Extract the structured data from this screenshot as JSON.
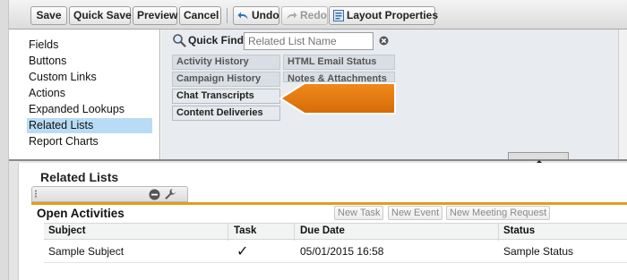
{
  "toolbar": {
    "save": "Save",
    "quick_save": "Quick Save",
    "preview": "Preview",
    "cancel": "Cancel",
    "undo": "Undo",
    "redo": "Redo",
    "layout_properties": "Layout Properties"
  },
  "palette": {
    "categories": [
      {
        "label": "Fields",
        "selected": false
      },
      {
        "label": "Buttons",
        "selected": false
      },
      {
        "label": "Custom Links",
        "selected": false
      },
      {
        "label": "Actions",
        "selected": false
      },
      {
        "label": "Expanded Lookups",
        "selected": false
      },
      {
        "label": "Related Lists",
        "selected": true
      },
      {
        "label": "Report Charts",
        "selected": false
      }
    ],
    "quick_find": {
      "label": "Quick Find",
      "placeholder": "Related List Name"
    },
    "items": [
      "Activity History",
      "HTML Email Status",
      "Campaign History",
      "Notes & Attachments",
      "Chat Transcripts",
      "Content Deliveries"
    ]
  },
  "layout": {
    "section_title": "Related Lists",
    "related_list": {
      "title": "Open Activities",
      "buttons": [
        "New Task",
        "New Event",
        "New Meeting Request"
      ],
      "columns": [
        "Subject",
        "Task",
        "Due Date",
        "Status"
      ],
      "rows": [
        {
          "subject": "Sample Subject",
          "task": "✓",
          "due_date": "05/01/2015 16:58",
          "status": "Sample Status"
        }
      ]
    }
  },
  "colors": {
    "accent_orange": "#e07a10",
    "section_rule": "#e59b1e",
    "selected_category": "#b8dcf5"
  },
  "icons": [
    "undo-icon",
    "redo-icon",
    "layout-properties-icon",
    "magnifier-icon",
    "clear-icon",
    "minus-icon",
    "wrench-icon"
  ]
}
